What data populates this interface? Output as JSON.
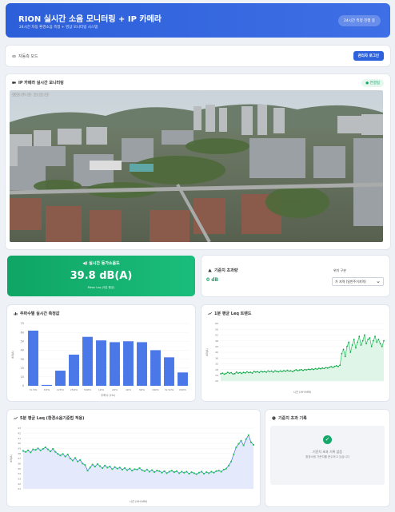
{
  "header": {
    "title": "RION 실시간 소음 모니터링 + IP 카메라",
    "subtitle": "24시간 자동 환경소음 측정 + 영상 모니터링 시스템",
    "badge": "24시간 측정 진행 중"
  },
  "monitor_bar": {
    "label": "자동측 모드",
    "button": "관리자 로그인"
  },
  "camera": {
    "title": "IP 카메라 실시간 모니터링",
    "status": "연결됨",
    "overlay_text": "2025-07-25 13:21:15"
  },
  "realtime": {
    "title": "실시간 등가소음도",
    "value": "39.8 dB(A)",
    "sub": "Mean Leq (5분 평균)"
  },
  "threshold": {
    "title": "기준치 초과량",
    "value": "0 dB",
    "select_label": "위치 구분",
    "select_value": "가 지역 (일반주거지역)"
  },
  "bar_chart": {
    "title": "주파수별 실시간 측정값",
    "xlabel": "주파수 (Hz)",
    "ylabel": "dB(A)"
  },
  "leq_chart": {
    "title": "1분 평균 Leq 트렌드",
    "xlabel": "시간 (HH:MM)",
    "ylabel": "dB(A)"
  },
  "env_chart": {
    "title": "5분 평균 Leq (환경소음기준법 적용)",
    "xlabel": "시간 (HH:MM)",
    "ylabel": "dB(A)"
  },
  "records": {
    "title": "기준치 초과 기록",
    "empty_line1": "기준치 초과 기록 없음",
    "empty_line2": "환경소음 기준치를 준수하고 있습니다"
  },
  "colors": {
    "primary": "#2d62dc",
    "success": "#15a86b",
    "bar": "#4a78e8",
    "line_green": "#22c55e",
    "line_blue": "#3b6fe0"
  },
  "chart_data": [
    {
      "type": "bar",
      "title": "주파수별 실시간 측정값",
      "categories": [
        "31.5Hz",
        "63Hz",
        "125Hz",
        "250Hz",
        "500Hz",
        "1kHz",
        "2kHz",
        "4kHz",
        "8kHz",
        "16kHz",
        "31.5kHz",
        "63kHz"
      ],
      "values": [
        62,
        1,
        17,
        35,
        55,
        51,
        49,
        50,
        49,
        40,
        32,
        15
      ],
      "ylim": [
        0,
        70
      ],
      "ylabel": "dB(A)",
      "xlabel": "주파수 (Hz)"
    },
    {
      "type": "area",
      "title": "1분 평균 Leq 트렌드",
      "ylim": [
        20,
        60
      ],
      "yticks": [
        20,
        24,
        28,
        32,
        36,
        40,
        44,
        48,
        52,
        56,
        60
      ],
      "values": [
        25,
        25.5,
        24.8,
        25.2,
        26,
        25.4,
        25.8,
        24.9,
        25.1,
        26.2,
        25.5,
        25.9,
        25.3,
        26,
        25.6,
        26.4,
        25.8,
        26.1,
        25.5,
        26.7,
        26.2,
        26.5,
        25.9,
        26.8,
        26.3,
        26.6,
        26.1,
        27,
        26.5,
        26.9,
        26.2,
        27.1,
        26.7,
        26.4,
        27,
        26.6,
        27.2,
        26.8,
        27.4,
        26.9,
        27.1,
        26.5,
        27.3,
        27.8,
        27.2,
        27.6,
        27.9,
        27.4,
        28,
        27.7,
        28.2,
        27.9,
        28.4,
        28,
        28.6,
        28.2,
        28.9,
        28.5,
        29,
        28.7,
        29.3,
        29,
        29.6,
        30,
        29.5,
        30.2,
        30.6,
        30.1,
        31,
        39,
        42,
        37,
        44,
        47,
        40,
        45,
        49,
        43,
        47,
        51,
        45,
        48,
        52,
        46,
        49,
        50,
        44,
        48,
        51,
        47,
        49,
        46,
        44,
        48
      ],
      "xlabel": "시간 (HH:MM)",
      "ylabel": "dB(A)"
    },
    {
      "type": "line",
      "title": "5분 평균 Leq (환경소음기준법 적용)",
      "ylim": [
        31,
        43
      ],
      "values": [
        38.5,
        38.3,
        38.6,
        38.2,
        38.8,
        38.7,
        39,
        38.6,
        38.9,
        39.2,
        38.8,
        38.4,
        38.9,
        38.3,
        37.9,
        37.6,
        37.9,
        37.4,
        37.8,
        37,
        36.6,
        37.1,
        36.4,
        36.7,
        36,
        35.7,
        34.6,
        35.2,
        35.8,
        35.4,
        35.9,
        35.5,
        35.1,
        35.6,
        35.2,
        35.4,
        34.9,
        35.3,
        35,
        35.2,
        34.8,
        35.1,
        34.7,
        35,
        34.6,
        34.9,
        34.8,
        35.1,
        34.7,
        34.5,
        34.8,
        34.4,
        34.7,
        34.3,
        34.6,
        34.5,
        34.2,
        34.5,
        34.1,
        34.4,
        34.6,
        34.3,
        34.5,
        34.1,
        34.4,
        34.2,
        34.4,
        34,
        34.3,
        34.1,
        33.9,
        34.2,
        34.4,
        34,
        34.3,
        34.1,
        34.4,
        34.2,
        34.5,
        34.6,
        34.4,
        34.8,
        35,
        35.6,
        36.4,
        37.8,
        39.2,
        39.9,
        40.5,
        39.6,
        40.8,
        41.6,
        40.2,
        39.7
      ],
      "xlabel": "시간 (HH:MM)",
      "ylabel": "dB(A)"
    }
  ]
}
